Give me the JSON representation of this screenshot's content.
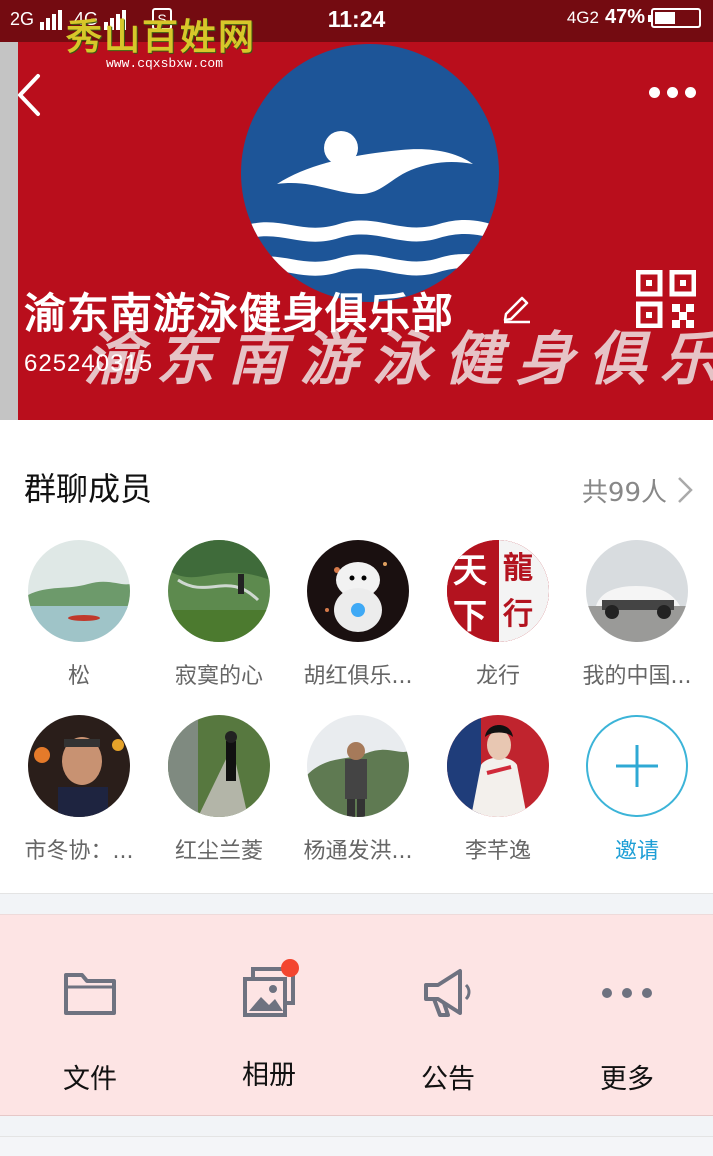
{
  "status_bar": {
    "sim1": "2G",
    "sim2": "4G",
    "sim_badge": "S",
    "time": "11:24",
    "network": "4G2",
    "battery": "47%",
    "battery_level": 0.47
  },
  "watermark": {
    "title": "秀山百姓网",
    "url": "www.cqxsbxw.com"
  },
  "header": {
    "group_name": "渝东南游泳健身俱乐部",
    "group_id": "625240315",
    "calligraphy": "渝东南游泳健身俱乐部"
  },
  "members": {
    "title": "群聊成员",
    "count": "共99人",
    "list": [
      {
        "name": "松"
      },
      {
        "name": "寂寞的心"
      },
      {
        "name": "胡红俱乐..."
      },
      {
        "name": "龙行",
        "avatar_text_a": "天",
        "avatar_text_b": "龍",
        "avatar_text_c": "下",
        "avatar_text_d": "行"
      },
      {
        "name": "我的中国..."
      },
      {
        "name": "市冬协：..."
      },
      {
        "name": "红尘兰菱"
      },
      {
        "name": "杨通发洪..."
      },
      {
        "name": "李芊逸"
      },
      {
        "name": "邀请"
      }
    ]
  },
  "tools": {
    "items": [
      {
        "label": "文件",
        "icon": "folder-icon"
      },
      {
        "label": "相册",
        "icon": "album-icon"
      },
      {
        "label": "公告",
        "icon": "megaphone-icon"
      },
      {
        "label": "更多",
        "icon": "more-icon"
      }
    ]
  },
  "colors": {
    "banner_red": "#b90e1c",
    "logo_blue": "#1d5598",
    "accent_blue": "#1e9fd6",
    "tools_bg": "#fde4e4",
    "notify_dot": "#f3452f"
  }
}
